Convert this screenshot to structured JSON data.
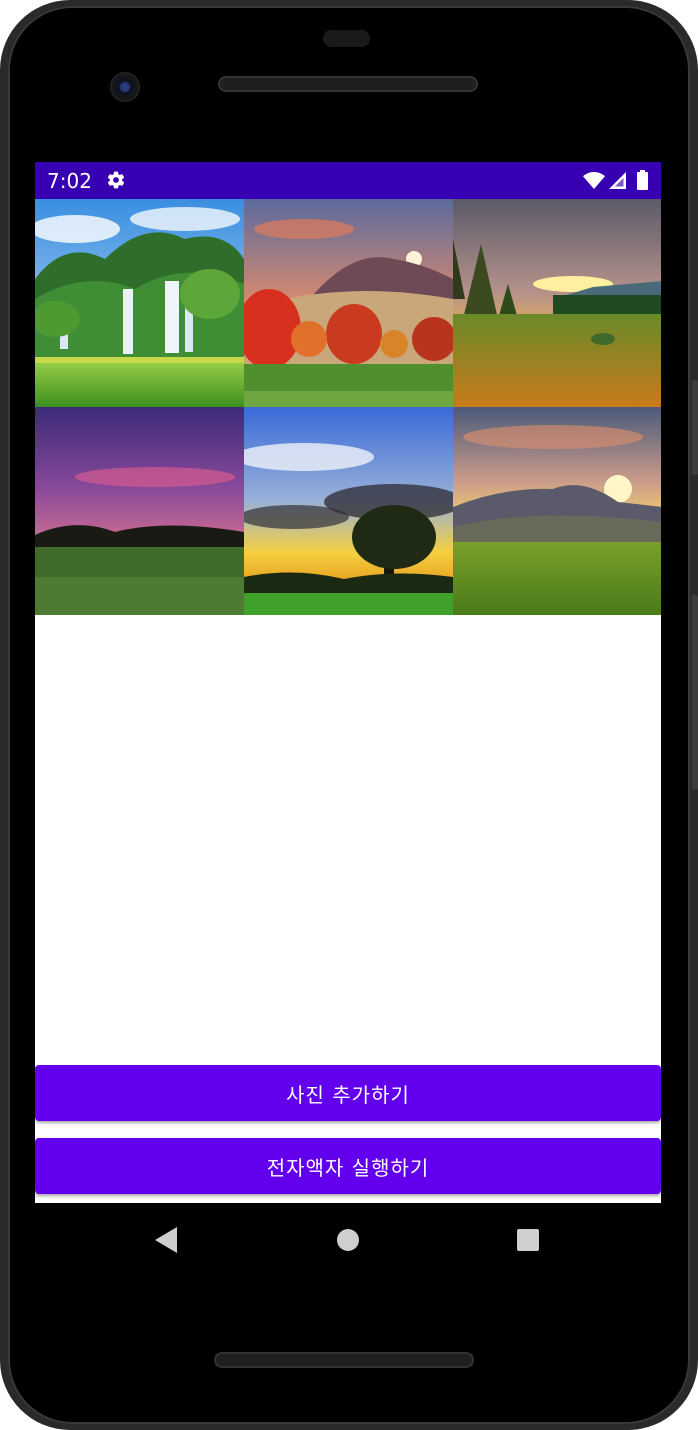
{
  "statusbar": {
    "time": "7:02",
    "background": "#3700b3"
  },
  "icons": {
    "settings": "gear-icon",
    "wifi": "wifi-icon",
    "signal": "cell-signal-icon",
    "battery": "battery-icon"
  },
  "gallery": {
    "photos": [
      {
        "subject": "waterfall"
      },
      {
        "subject": "autumn-trees-mountain"
      },
      {
        "subject": "forest-sunset"
      },
      {
        "subject": "purple-sky-field"
      },
      {
        "subject": "tree-cloudy-sunset"
      },
      {
        "subject": "mountain-sunrise"
      }
    ]
  },
  "buttons": {
    "add_photo": "사진 추가하기",
    "run_frame": "전자액자 실행하기",
    "color": "#6200ee"
  },
  "navbar": {
    "back": "back-icon",
    "home": "home-icon",
    "recent": "recents-icon"
  }
}
